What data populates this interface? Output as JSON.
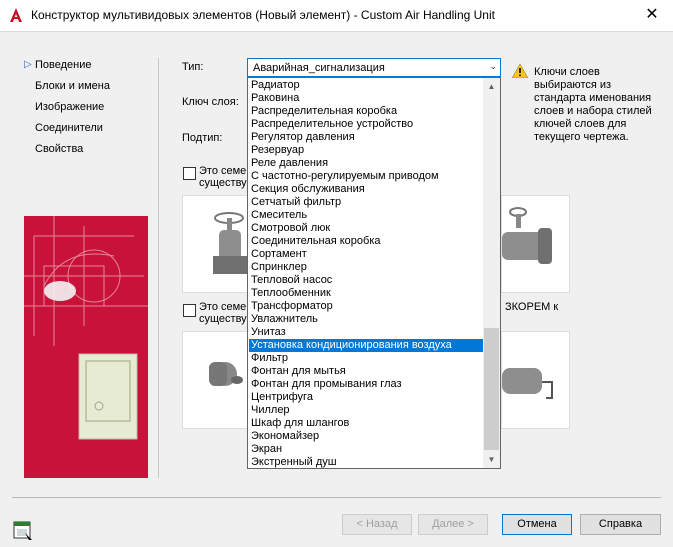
{
  "window": {
    "title": "Конструктор мультивидовых элементов (Новый элемент) - Custom Air Handling Unit",
    "close_glyph": "✕"
  },
  "nav": [
    {
      "label": "Поведение",
      "active": true
    },
    {
      "label": "Блоки и имена",
      "active": false
    },
    {
      "label": "Изображение",
      "active": false
    },
    {
      "label": "Соединители",
      "active": false
    },
    {
      "label": "Свойства",
      "active": false
    }
  ],
  "form": {
    "type_label": "Тип:",
    "layer_key_label": "Ключ слоя:",
    "subtype_label": "Подтип:",
    "type_value": "Аварийная_сигнализация"
  },
  "warning_text": "Ключи слоев выбираются из стандарта именования слоев и набора стилей ключей слоев для текущего чертежа.",
  "checkbox1_text": "Это семей...\nсуществу...",
  "checkbox1": {
    "line1": "Это семей",
    "line2": "существу"
  },
  "checkbox2": {
    "line1": "Это семей",
    "line2": "существу",
    "right_text": "ЗКОРЕМ к"
  },
  "dropdown_items": [
    "Радиатор",
    "Раковина",
    "Распределительная коробка",
    "Распределительное устройство",
    "Регулятор давления",
    "Резервуар",
    "Реле давления",
    "С частотно-регулируемым приводом",
    "Секция обслуживания",
    "Сетчатый фильтр",
    "Смеситель",
    "Смотровой люк",
    "Соединительная коробка",
    "Сортамент",
    "Спринклер",
    "Тепловой насос",
    "Теплообменник",
    "Трансформатор",
    "Увлажнитель",
    "Унитаз",
    "Установка кондиционирования воздуха",
    "Фильтр",
    "Фонтан для мытья",
    "Фонтан для промывания глаз",
    "Центрифуга",
    "Чиллер",
    "Шкаф для шлангов",
    "Экономайзер",
    "Экран",
    "Экстренный душ"
  ],
  "selected_item": "Установка кондиционирования воздуха",
  "buttons": {
    "back": "< Назад",
    "next": "Далее >",
    "cancel": "Отмена",
    "help": "Справка"
  },
  "colors": {
    "accent": "#0078d7",
    "illustration": "#c8123a",
    "warning": "#f5c518"
  },
  "icons": {
    "app": "autocad-a-icon",
    "warning": "warning-triangle-icon"
  }
}
